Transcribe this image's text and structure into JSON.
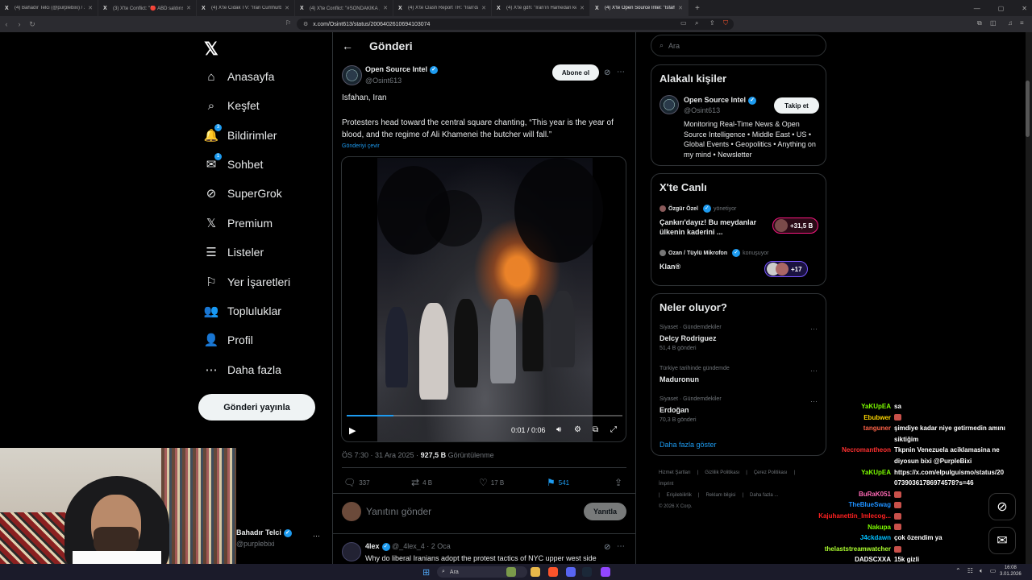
{
  "browser": {
    "tabs": [
      {
        "label": "(4) Bahadır Telci (@purplebixi) / X",
        "active": false
      },
      {
        "label": "(3) X'te Conflict: \"🔴 ABD saldırısının...",
        "active": false
      },
      {
        "label": "(4) X'te Cıdak TV: \"İran Cumhurbaşkanı...",
        "active": false
      },
      {
        "label": "(4) X'te Conflict: \"#SONDAKİKA 🚨 İr...",
        "active": false
      },
      {
        "label": "(4) X'te Clash Report TR: \"İran'da Bugün...",
        "active": false
      },
      {
        "label": "(4) X'te gdh: \"İran'ın Hamedan kenti...",
        "active": false
      },
      {
        "label": "(4) X'te Open Source Intel: \"Isfahan...",
        "active": true
      }
    ],
    "url": "x.com/Osint613/status/2006402610694103074"
  },
  "nav": {
    "items": [
      {
        "label": "Anasayfa",
        "icon": "home-icon",
        "glyph": "⌂"
      },
      {
        "label": "Keşfet",
        "icon": "search-icon",
        "glyph": "⌕"
      },
      {
        "label": "Bildirimler",
        "icon": "bell-icon",
        "glyph": "🔔",
        "badge": "3"
      },
      {
        "label": "Sohbet",
        "icon": "mail-icon",
        "glyph": "✉",
        "badge": "1"
      },
      {
        "label": "SuperGrok",
        "icon": "grok-icon",
        "glyph": "⊘"
      },
      {
        "label": "Premium",
        "icon": "x-premium-icon",
        "glyph": "𝕏"
      },
      {
        "label": "Listeler",
        "icon": "list-icon",
        "glyph": "☰"
      },
      {
        "label": "Yer İşaretleri",
        "icon": "bookmark-icon",
        "glyph": "⚐"
      },
      {
        "label": "Topluluklar",
        "icon": "communities-icon",
        "glyph": "👥"
      },
      {
        "label": "Profil",
        "icon": "profile-icon",
        "glyph": "👤"
      },
      {
        "label": "Daha fazla",
        "icon": "more-circle-icon",
        "glyph": "⋯"
      }
    ],
    "post_button": "Gönderi yayınla"
  },
  "main": {
    "title": "Gönderi",
    "author": {
      "name": "Open Source Intel",
      "handle": "@Osint613"
    },
    "subscribe_label": "Abone ol",
    "location": "Isfahan, Iran",
    "text": "Protesters head toward the central square chanting, “This year is the year of blood, and the regime of Ali Khamenei the butcher will fall.”",
    "translate": "Gönderiyi çevir",
    "video": {
      "timecode": "0:01 / 0:06",
      "progress": 0.17
    },
    "meta": {
      "time": "ÖS 7:30 · 31 Ara 2025 · ",
      "views": "927,5 B",
      "views_label": " Görüntülenme"
    },
    "stats": {
      "replies": "337",
      "reposts": "4 B",
      "likes": "17 B",
      "bookmarks": "541"
    },
    "reply_placeholder": "Yanıtını gönder",
    "reply_button": "Yanıtla",
    "next_reply": {
      "name": "4lex",
      "handle": "@_4lex_4",
      "date": "· 2 Oca",
      "text": "Why do liberal Iranians adopt the protest tactics of NYC upper west side"
    }
  },
  "right": {
    "search_placeholder": "Ara",
    "related": {
      "title": "Alakalı kişiler",
      "name": "Open Source Intel",
      "handle": "@Osint613",
      "follow": "Takip et",
      "bio": "Monitoring Real-Time News & Open Source Intelligence • Middle East • US • Global Events • Geopolitics • Anything on my mind • Newsletter"
    },
    "live": {
      "title": "X'te Canlı",
      "items": [
        {
          "host": "Özgür Özel",
          "role": "yönetiyor",
          "title": "Çankırı'dayız! Bu meydanlar ülkenin kaderini ...",
          "count": "+31,5 B",
          "color": "#f91880"
        },
        {
          "host": "Ozan / Tüylü Mikrofon",
          "role": "konuşuyor",
          "title": "Klan®",
          "count": "+17",
          "color": "#7856ff"
        }
      ]
    },
    "trends": {
      "title": "Neler oluyor?",
      "items": [
        {
          "category": "Siyaset · Gündemdekiler",
          "name": "Delcy Rodriguez",
          "count": "51,4 B gönderi"
        },
        {
          "category": "Türkiye tarihinde gündemde",
          "name": "Maduronun",
          "count": ""
        },
        {
          "category": "Siyaset · Gündemdekiler",
          "name": "Erdoğan",
          "count": "70,3 B gönderi"
        }
      ],
      "show_more": "Daha fazla göster"
    },
    "footer": [
      "Hizmet Şartları",
      "|",
      "Gizlilik Politikası",
      "|",
      "Çerez Politikası",
      "|",
      "İmprint",
      "|",
      "Erişilebilirlik",
      "|",
      "Reklam bilgisi",
      "|",
      "Daha fazla ...",
      "© 2026 X Corp."
    ]
  },
  "stream": {
    "name": "Bahadır Telci",
    "handle": "@purplebixi",
    "chat": [
      {
        "user": "YaKUpEA",
        "msg": "sa",
        "color": "#7cfc00"
      },
      {
        "user": "Ebubwer",
        "msg": "",
        "color": "#ffd700"
      },
      {
        "user": "tanguner",
        "msg": "şimdiye kadar niye getirmedin amını",
        "color": "#ff6347"
      },
      {
        "user": "",
        "msg": "siktiğim",
        "color": "#ff6347"
      },
      {
        "user": "Necromantheon",
        "msg": "Tkpnin Venezuela aciklamasina ne",
        "color": "#ff3030"
      },
      {
        "user": "",
        "msg": "diyosun bixi @PurpleBixi",
        "color": "#ff3030"
      },
      {
        "user": "YaKUpEA",
        "msg": "https://x.com/elpulguismo/status/20",
        "color": "#7cfc00"
      },
      {
        "user": "",
        "msg": "07390361786974578?s=46",
        "color": "#7cfc00"
      },
      {
        "user": "BuRaK051",
        "msg": "",
        "color": "#ff69b4"
      },
      {
        "user": "TheBlueSwag",
        "msg": "",
        "color": "#1e90ff"
      },
      {
        "user": "Kajuhanettin_Imlecog...",
        "msg": "",
        "color": "#ff2020"
      },
      {
        "user": "Nakupa",
        "msg": "",
        "color": "#7cfc00"
      },
      {
        "user": "J4ckdawn",
        "msg": "çok özendim ya",
        "color": "#00bfff"
      },
      {
        "user": "thelaststreamwatcher",
        "msg": "",
        "color": "#adff2f"
      },
      {
        "user": "DADSCXXA",
        "msg": "15k gizli",
        "color": "#ffffff"
      },
      {
        "user": "Ebubwer",
        "msg": "",
        "color": "#ffd700"
      }
    ]
  },
  "taskbar": {
    "search": "Ara",
    "time": "16:08",
    "date": "3.01.2026"
  }
}
